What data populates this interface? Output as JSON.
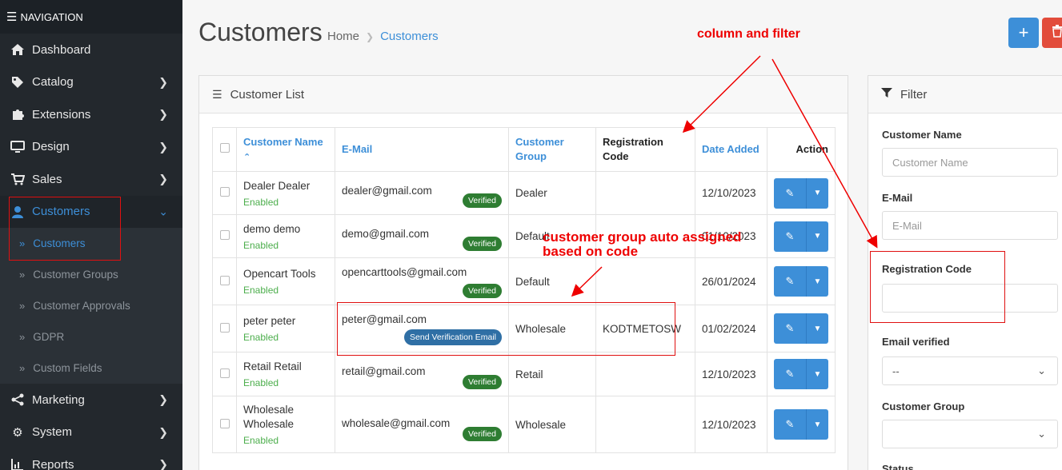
{
  "sidebar": {
    "header": "NAVIGATION",
    "items": [
      {
        "label": "Dashboard",
        "icon": "home-icon"
      },
      {
        "label": "Catalog",
        "icon": "tag-icon"
      },
      {
        "label": "Extensions",
        "icon": "puzzle-icon"
      },
      {
        "label": "Design",
        "icon": "monitor-icon"
      },
      {
        "label": "Sales",
        "icon": "cart-icon"
      },
      {
        "label": "Customers",
        "icon": "user-icon"
      }
    ],
    "sub_items": [
      {
        "label": "Customers"
      },
      {
        "label": "Customer Groups"
      },
      {
        "label": "Customer Approvals"
      },
      {
        "label": "GDPR"
      },
      {
        "label": "Custom Fields"
      }
    ],
    "items_after": [
      {
        "label": "Marketing",
        "icon": "share-icon"
      },
      {
        "label": "System",
        "icon": "gear-icon"
      },
      {
        "label": "Reports",
        "icon": "chart-icon"
      }
    ]
  },
  "header": {
    "title": "Customers",
    "breadcrumb": [
      "Home",
      "Customers"
    ]
  },
  "list": {
    "title": "Customer List",
    "columns": {
      "name": "Customer Name",
      "email": "E-Mail",
      "group": "Customer Group",
      "code": "Registration Code",
      "date": "Date Added",
      "action": "Action"
    },
    "rows": [
      {
        "name": "Dealer Dealer",
        "status": "Enabled",
        "email": "dealer@gmail.com",
        "badge": "Verified",
        "group": "Dealer",
        "code": "",
        "date": "12/10/2023"
      },
      {
        "name": "demo demo",
        "status": "Enabled",
        "email": "demo@gmail.com",
        "badge": "Verified",
        "group": "Default",
        "code": "",
        "date": "01/10/2023"
      },
      {
        "name": "Opencart Tools",
        "status": "Enabled",
        "email": "opencarttools@gmail.com",
        "badge": "Verified",
        "group": "Default",
        "code": "",
        "date": "26/01/2024"
      },
      {
        "name": "peter peter",
        "status": "Enabled",
        "email": "peter@gmail.com",
        "badge": "Send Verification Email",
        "group": "Wholesale",
        "code": "KODTMETOSW",
        "date": "01/02/2024"
      },
      {
        "name": "Retail Retail",
        "status": "Enabled",
        "email": "retail@gmail.com",
        "badge": "Verified",
        "group": "Retail",
        "code": "",
        "date": "12/10/2023"
      },
      {
        "name": "Wholesale Wholesale",
        "status": "Enabled",
        "email": "wholesale@gmail.com",
        "badge": "Verified",
        "group": "Wholesale",
        "code": "",
        "date": "12/10/2023"
      }
    ]
  },
  "filter": {
    "title": "Filter",
    "customer_name_label": "Customer Name",
    "customer_name_placeholder": "Customer Name",
    "email_label": "E-Mail",
    "email_placeholder": "E-Mail",
    "reg_code_label": "Registration Code",
    "email_verified_label": "Email verified",
    "email_verified_value": "--",
    "customer_group_label": "Customer Group",
    "status_label": "Status"
  },
  "annotations": {
    "column_filter": "column and filter",
    "group_auto_line1": "customer group auto assigned",
    "group_auto_line2": "based on code"
  },
  "colors": {
    "accent": "#3d8fd8",
    "sidebar_bg": "#23282d",
    "verified_badge": "#2e7d32",
    "danger": "#e24c3b",
    "annotation": "#ee0000"
  }
}
